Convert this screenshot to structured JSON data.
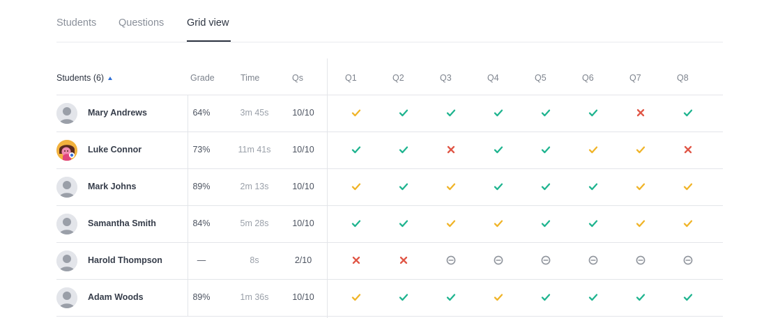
{
  "tabs": [
    {
      "label": "Students",
      "active": false
    },
    {
      "label": "Questions",
      "active": false
    },
    {
      "label": "Grid view",
      "active": true
    }
  ],
  "table": {
    "headers": {
      "students": "Students (6)",
      "grade": "Grade",
      "time": "Time",
      "qs": "Qs",
      "questions": [
        "Q1",
        "Q2",
        "Q3",
        "Q4",
        "Q5",
        "Q6",
        "Q7",
        "Q8"
      ]
    },
    "rows": [
      {
        "name": "Mary Andrews",
        "avatar": "default",
        "grade": "64%",
        "time": "3m 45s",
        "qs": "10/10",
        "results": [
          "partial",
          "correct",
          "correct",
          "correct",
          "correct",
          "correct",
          "incorrect",
          "correct"
        ]
      },
      {
        "name": "Luke Connor",
        "avatar": "photo",
        "grade": "73%",
        "time": "11m 41s",
        "qs": "10/10",
        "results": [
          "correct",
          "correct",
          "incorrect",
          "correct",
          "correct",
          "partial",
          "partial",
          "incorrect"
        ]
      },
      {
        "name": "Mark Johns",
        "avatar": "default",
        "grade": "89%",
        "time": "2m 13s",
        "qs": "10/10",
        "results": [
          "partial",
          "correct",
          "partial",
          "correct",
          "correct",
          "correct",
          "partial",
          "partial"
        ]
      },
      {
        "name": "Samantha Smith",
        "avatar": "default",
        "grade": "84%",
        "time": "5m 28s",
        "qs": "10/10",
        "results": [
          "correct",
          "correct",
          "partial",
          "partial",
          "correct",
          "correct",
          "partial",
          "partial"
        ]
      },
      {
        "name": "Harold Thompson",
        "avatar": "default",
        "grade": "—",
        "time": "8s",
        "qs": "2/10",
        "results": [
          "incorrect",
          "incorrect",
          "unanswered",
          "unanswered",
          "unanswered",
          "unanswered",
          "unanswered",
          "unanswered"
        ]
      },
      {
        "name": "Adam Woods",
        "avatar": "default",
        "grade": "89%",
        "time": "1m 36s",
        "qs": "10/10",
        "results": [
          "partial",
          "correct",
          "correct",
          "partial",
          "correct",
          "correct",
          "correct",
          "correct"
        ]
      }
    ]
  },
  "colors": {
    "correct": "#1fb48f",
    "partial": "#f0b428",
    "incorrect": "#e05646",
    "unanswered": "#8f949c"
  }
}
